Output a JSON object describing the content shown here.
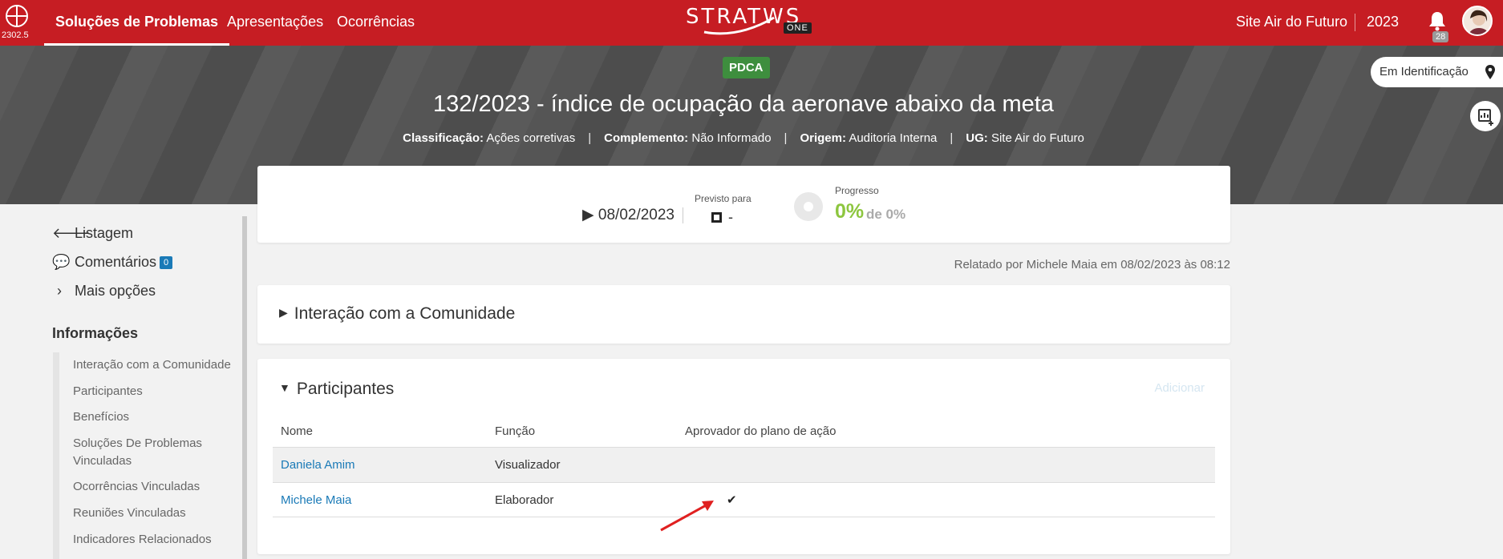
{
  "topbar": {
    "version": "2302.5",
    "nav": [
      "Soluções de Problemas",
      "Apresentações",
      "Ocorrências"
    ],
    "brand": "STRATWS",
    "brand_suffix": "ONE",
    "site": "Site Air do Futuro",
    "year": "2023",
    "notifications": "28"
  },
  "header": {
    "badge": "PDCA",
    "title": "132/2023 - índice de ocupação da aeronave abaixo da meta",
    "meta": {
      "classificacao_label": "Classificação:",
      "classificacao": "Ações corretivas",
      "complemento_label": "Complemento:",
      "complemento": "Não Informado",
      "origem_label": "Origem:",
      "origem": "Auditoria Interna",
      "ug_label": "UG:",
      "ug": "Site Air do Futuro"
    },
    "status": "Em Identificação"
  },
  "sidebar": {
    "links": [
      "Listagem",
      "Comentários",
      "Mais opções"
    ],
    "comments_count": "0",
    "info_title": "Informações",
    "items": [
      "Interação com a Comunidade",
      "Participantes",
      "Benefícios",
      "Soluções De Problemas Vinculadas",
      "Ocorrências Vinculadas",
      "Reuniões Vinculadas",
      "Indicadores Relacionados"
    ]
  },
  "summary": {
    "start_date": "08/02/2023",
    "expected_label": "Previsto para",
    "expected_value": "-",
    "progress_label": "Progresso",
    "progress_value": "0%",
    "progress_of": "de 0%"
  },
  "reported": "Relatado por Michele Maia em 08/02/2023 às 08:12",
  "sections": {
    "interacao": "Interação com a Comunidade",
    "participantes": "Participantes",
    "add": "Adicionar"
  },
  "participants": {
    "columns": [
      "Nome",
      "Função",
      "Aprovador do plano de ação"
    ],
    "rows": [
      {
        "name": "Daniela Amim",
        "role": "Visualizador",
        "approver": ""
      },
      {
        "name": "Michele Maia",
        "role": "Elaborador",
        "approver": "✔"
      }
    ]
  },
  "colors": {
    "primary_red": "#c61d23",
    "pdca_green": "#3e8e3e",
    "link_blue": "#1a7ab7",
    "progress_green": "#8dc63f"
  }
}
